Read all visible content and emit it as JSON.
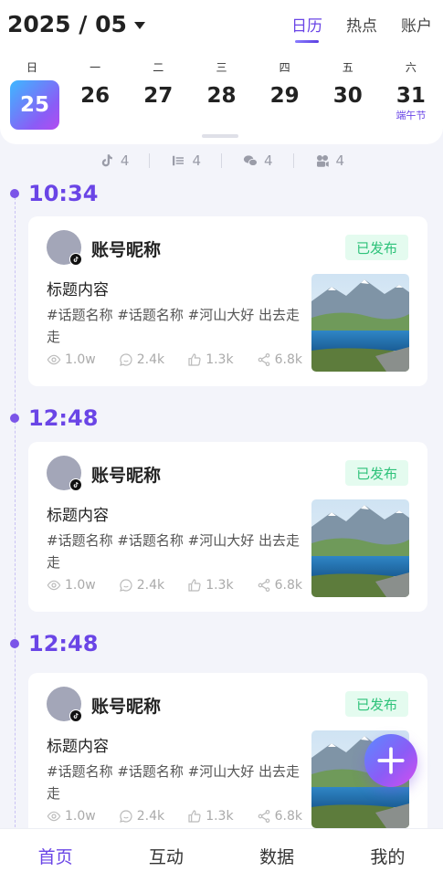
{
  "header": {
    "month": "2025 / 05",
    "tabs": [
      {
        "label": "日历",
        "active": true
      },
      {
        "label": "热点",
        "active": false
      },
      {
        "label": "账户",
        "active": false
      }
    ]
  },
  "week": [
    {
      "weekday": "日",
      "date": "25",
      "active": true,
      "festival": ""
    },
    {
      "weekday": "一",
      "date": "26",
      "active": false,
      "festival": ""
    },
    {
      "weekday": "二",
      "date": "27",
      "active": false,
      "festival": ""
    },
    {
      "weekday": "三",
      "date": "28",
      "active": false,
      "festival": ""
    },
    {
      "weekday": "四",
      "date": "29",
      "active": false,
      "festival": ""
    },
    {
      "weekday": "五",
      "date": "30",
      "active": false,
      "festival": ""
    },
    {
      "weekday": "六",
      "date": "31",
      "active": false,
      "festival": "端午节"
    }
  ],
  "platforms": [
    {
      "icon": "douyin-icon",
      "count": "4"
    },
    {
      "icon": "xiaohongshu-icon",
      "count": "4"
    },
    {
      "icon": "wechat-icon",
      "count": "4"
    },
    {
      "icon": "video-channel-icon",
      "count": "4"
    }
  ],
  "posts": [
    {
      "time": "10:34",
      "nickname": "账号昵称",
      "status": "已发布",
      "title": "标题内容",
      "tags": "#话题名称 #话题名称 #河山大好 出去走走",
      "views": "1.0w",
      "comments": "2.4k",
      "likes": "1.3k",
      "shares": "6.8k"
    },
    {
      "time": "12:48",
      "nickname": "账号昵称",
      "status": "已发布",
      "title": "标题内容",
      "tags": "#话题名称 #话题名称 #河山大好 出去走走",
      "views": "1.0w",
      "comments": "2.4k",
      "likes": "1.3k",
      "shares": "6.8k"
    },
    {
      "time": "12:48",
      "nickname": "账号昵称",
      "status": "已发布",
      "title": "标题内容",
      "tags": "#话题名称 #话题名称 #河山大好 出去走走",
      "views": "1.0w",
      "comments": "2.4k",
      "likes": "1.3k",
      "shares": "6.8k"
    }
  ],
  "bottom_nav": [
    {
      "label": "首页",
      "active": true
    },
    {
      "label": "互动",
      "active": false
    },
    {
      "label": "数据",
      "active": false
    },
    {
      "label": "我的",
      "active": false
    }
  ],
  "colors": {
    "accent": "#6a45e6",
    "published_bg": "#e4fbef",
    "published_text": "#2ec27a",
    "background": "#f3f4fa"
  }
}
